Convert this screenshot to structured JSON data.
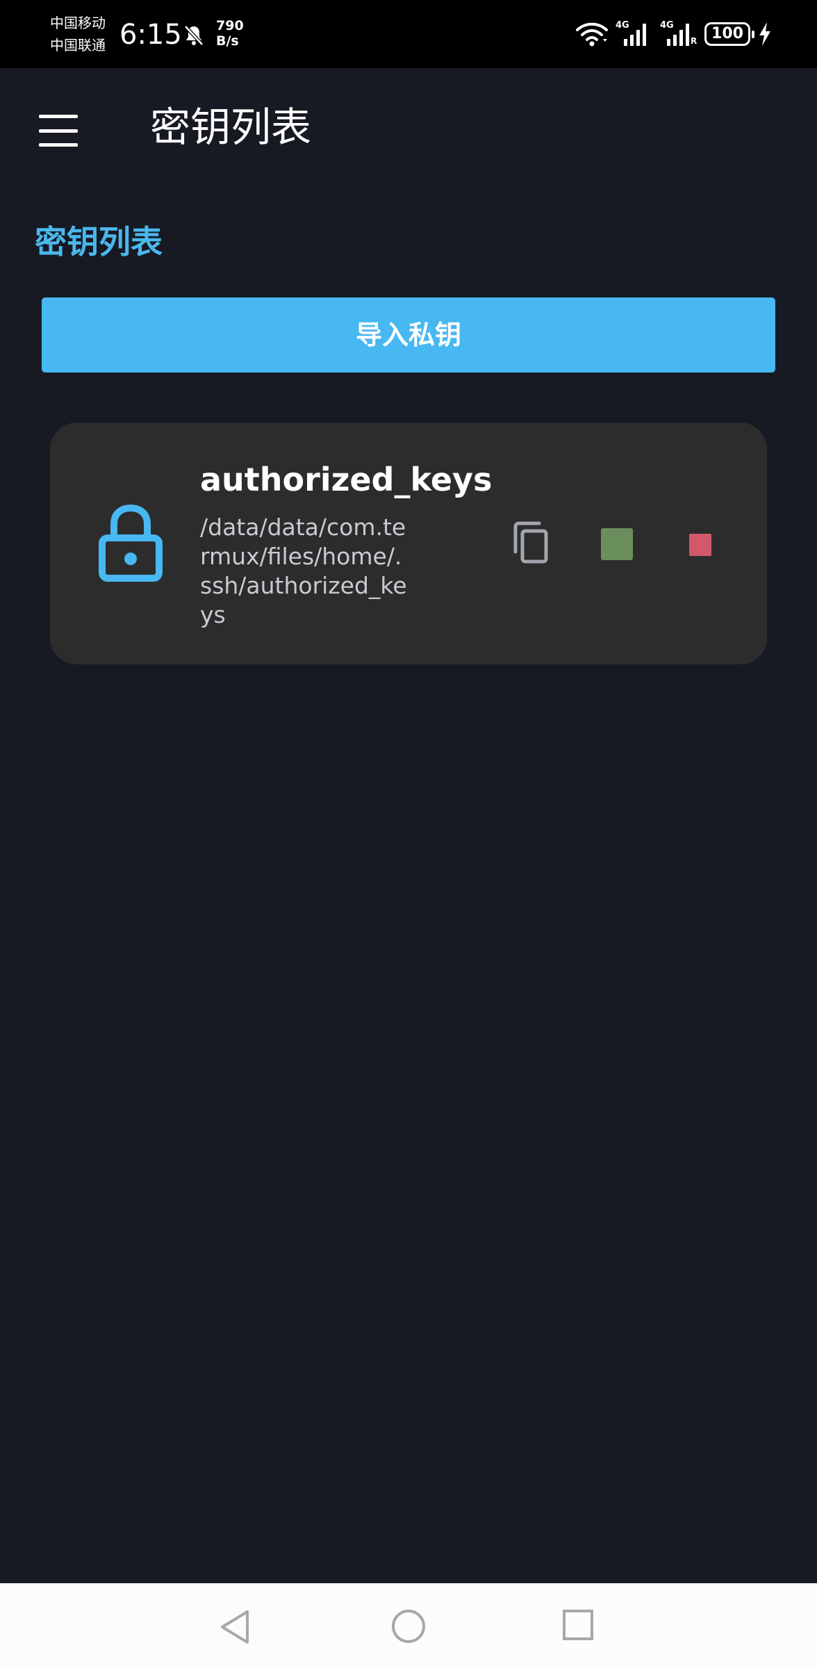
{
  "status_bar": {
    "carrier_1": "中国移动",
    "carrier_2": "中国联通",
    "time": "6:15",
    "net_speed_value": "790",
    "net_speed_unit": "B/s",
    "sim1_label": "4G",
    "sim2_label": "4G",
    "sim2_roaming": "R",
    "battery_level": "100",
    "icons": [
      "bell-off-icon",
      "wifi-icon",
      "signal-icon",
      "signal-icon",
      "battery-icon",
      "charging-icon"
    ]
  },
  "app_bar": {
    "title": "密钥列表",
    "menu_icon": "menu-icon"
  },
  "section": {
    "title": "密钥列表"
  },
  "actions": {
    "import_label": "导入私钥"
  },
  "keys": [
    {
      "name": "authorized_keys",
      "path": "/data/data/com.termux/files/home/.ssh/authorized_keys",
      "icon": "lock-icon",
      "actions": [
        "copy-icon",
        "green-square-button",
        "red-square-button"
      ]
    }
  ],
  "nav_bar": {
    "icons": [
      "back-icon",
      "home-icon",
      "recents-icon"
    ]
  },
  "colors": {
    "background": "#171923",
    "accent": "#47b8f1",
    "card": "#2c2c2c",
    "green": "#6b8e5d",
    "red": "#d2596c"
  }
}
